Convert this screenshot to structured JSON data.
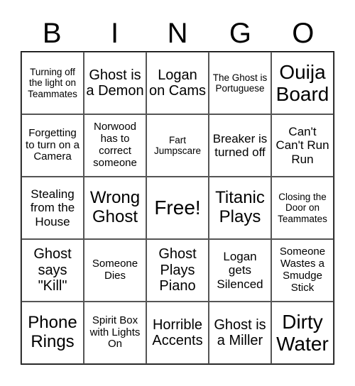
{
  "header": {
    "letters": [
      "B",
      "I",
      "N",
      "G",
      "O"
    ]
  },
  "cells": [
    {
      "text": "Turning off the light on Teammates",
      "size": "s1"
    },
    {
      "text": "Ghost is a Demon",
      "size": "s4"
    },
    {
      "text": "Logan on Cams",
      "size": "s4"
    },
    {
      "text": "The Ghost is Portuguese",
      "size": "s1"
    },
    {
      "text": "Ouija Board",
      "size": "s6"
    },
    {
      "text": "Forgetting to turn on a Camera",
      "size": "s2"
    },
    {
      "text": "Norwood has to correct someone",
      "size": "s2"
    },
    {
      "text": "Fart Jumpscare",
      "size": "s1"
    },
    {
      "text": "Breaker is turned off",
      "size": "s3"
    },
    {
      "text": "Can't Can't Run Run",
      "size": "s3"
    },
    {
      "text": "Stealing from the House",
      "size": "s3"
    },
    {
      "text": "Wrong Ghost",
      "size": "s5"
    },
    {
      "text": "Free!",
      "size": "s6"
    },
    {
      "text": "Titanic Plays",
      "size": "s5"
    },
    {
      "text": "Closing the Door on Teammates",
      "size": "s1"
    },
    {
      "text": "Ghost says \"Kill\"",
      "size": "s4"
    },
    {
      "text": "Someone Dies",
      "size": "s2"
    },
    {
      "text": "Ghost Plays Piano",
      "size": "s4"
    },
    {
      "text": "Logan gets Silenced",
      "size": "s3"
    },
    {
      "text": "Someone Wastes a Smudge Stick",
      "size": "s2"
    },
    {
      "text": "Phone Rings",
      "size": "s5"
    },
    {
      "text": "Spirit Box with Lights On",
      "size": "s2"
    },
    {
      "text": "Horrible Accents",
      "size": "s4"
    },
    {
      "text": "Ghost is a Miller",
      "size": "s4"
    },
    {
      "text": "Dirty Water",
      "size": "s6"
    }
  ]
}
